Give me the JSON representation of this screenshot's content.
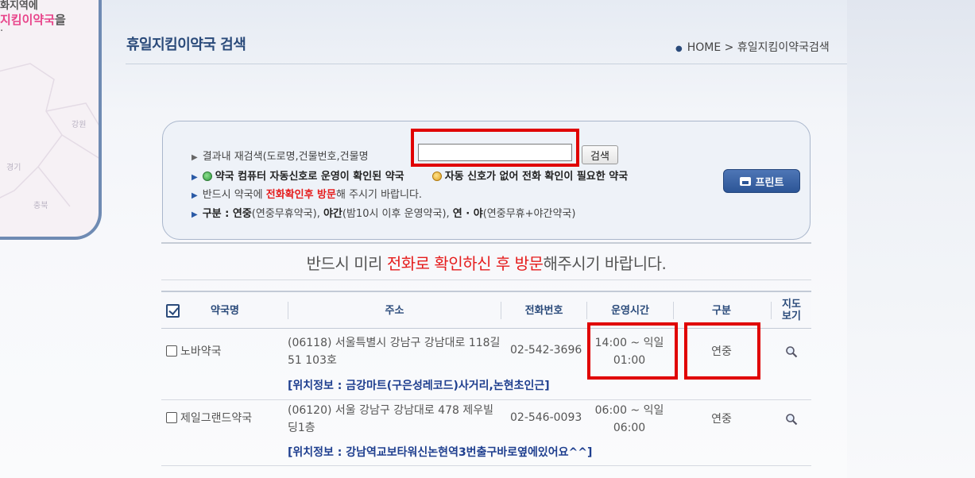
{
  "left_panel": {
    "line1": "화지역에",
    "line2_highlight": "지킴이약국",
    "line2_rest": "을",
    "regions": [
      "강원",
      "경기",
      "충북"
    ]
  },
  "header": {
    "title": "휴일지킴이약국 검색",
    "breadcrumb_home": "HOME",
    "breadcrumb_sep": ">",
    "breadcrumb_current": "휴일지킴이약국검색"
  },
  "search": {
    "label": "결과내 재검색(도로명,건물번호,건물명",
    "input_value": "",
    "button_label": "검색",
    "legend_green": "약국 컴퓨터 자동신호로 운영이 확인된 약국",
    "legend_orange": "자동 신호가 없어 전화 확인이 필요한 약국",
    "visit_pre": "반드시 약국에 ",
    "visit_red": "전화확인후 방문",
    "visit_post": "해 주시기 바랍니다.",
    "types_label": "구분 : ",
    "type1": "연중",
    "type1_desc": "(연중무휴약국), ",
    "type2": "야간",
    "type2_desc": "(밤10시 이후 운영약국), ",
    "type3": "연 · 야",
    "type3_desc": "(연중무휴+야간약국)",
    "print_label": "프린트"
  },
  "notice": {
    "pre": "반드시 미리 ",
    "red": "전화로 확인하신 후 방문",
    "post": "해주시기 바랍니다."
  },
  "table": {
    "columns": {
      "name": "약국명",
      "address": "주소",
      "phone": "전화번호",
      "hours": "운영시간",
      "type": "구분",
      "map_line1": "지도",
      "map_line2": "보기"
    },
    "rows": [
      {
        "name": "노바약국",
        "address": "(06118) 서울특별시 강남구 강남대로 118길 51 103호",
        "location": "[위치정보 : 금강마트(구은성레코드)사거리,논현초인근]",
        "phone": "02-542-3696",
        "hours": "14:00 ~ 익일 01:00",
        "type": "연중"
      },
      {
        "name": "제일그랜드약국",
        "address": "(06120) 서울 강남구 강남대로 478 제우빌딩1층",
        "location": "[위치정보 : 강남역교보타워신논현역3번출구바로옆에있어요^^]",
        "phone": "02-546-0093",
        "hours": "06:00 ~ 익일 06:00",
        "type": "연중"
      }
    ]
  },
  "colors": {
    "highlight": "#e00000",
    "title": "#2a4a7a",
    "accent_red": "#e51c1c"
  }
}
